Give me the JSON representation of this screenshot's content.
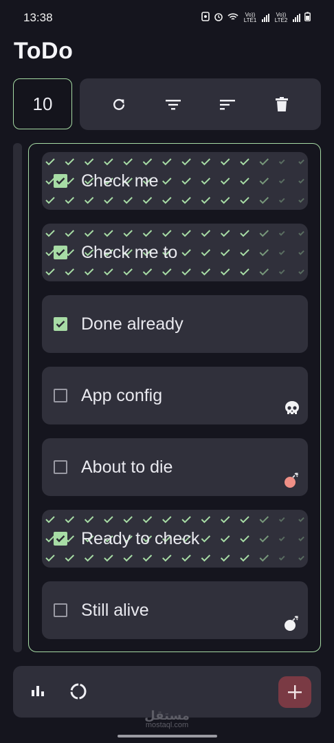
{
  "status_bar": {
    "time": "13:38",
    "sim1_label": "Vo)) LTE1",
    "sim2_label": "Vo)) LTE2",
    "icons": [
      "screenshot-icon",
      "alarm-icon",
      "wifi-icon",
      "signal-icon",
      "battery-icon"
    ]
  },
  "app": {
    "title": "ToDo"
  },
  "counter": {
    "value": "10"
  },
  "toolbar": {
    "buttons": [
      "refresh-icon",
      "filter-icon",
      "sort-icon",
      "delete-icon"
    ]
  },
  "tasks": [
    {
      "label": "Check me",
      "checked": true,
      "pattern": "checkmarks",
      "badge": ""
    },
    {
      "label": "Check me to",
      "checked": true,
      "pattern": "checkmarks",
      "badge": ""
    },
    {
      "label": "Done already",
      "checked": true,
      "pattern": "",
      "badge": ""
    },
    {
      "label": "App config",
      "checked": false,
      "pattern": "",
      "badge": "skull-icon"
    },
    {
      "label": "About to die",
      "checked": false,
      "pattern": "",
      "badge": "bomb-icon"
    },
    {
      "label": "Ready to check",
      "checked": true,
      "pattern": "checkmarks",
      "badge": ""
    },
    {
      "label": "Still alive",
      "checked": false,
      "pattern": "",
      "badge": "bomb-icon"
    }
  ],
  "bottom_bar": {
    "icons": [
      "bar-chart-icon",
      "progress-ring-icon",
      "plus-icon"
    ]
  },
  "watermark": {
    "text": "مستقل",
    "subtext": "mostaql.com"
  },
  "colors": {
    "background": "#15151e",
    "card": "#30303b",
    "accent_green": "#a7dca5",
    "add_button": "#7a3a44",
    "bomb_red": "#ef8f86"
  }
}
